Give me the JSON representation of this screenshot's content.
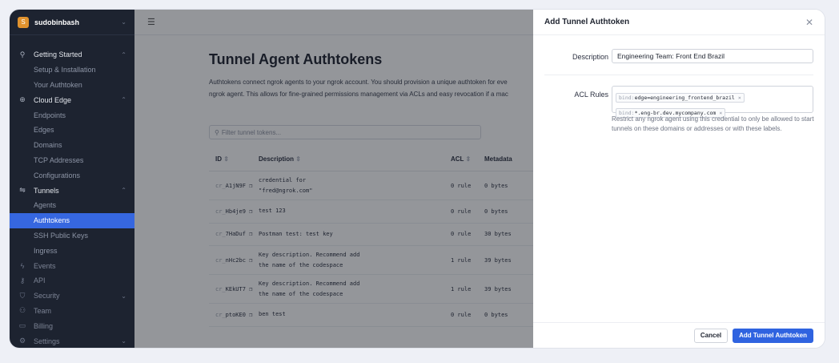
{
  "sidebar": {
    "account": {
      "initial": "S",
      "name": "sudobinbash"
    },
    "items": [
      {
        "label": "Getting Started",
        "type": "section",
        "icon": "rocket-icon",
        "glyph": "⚲",
        "caret": "^"
      },
      {
        "label": "Setup & Installation",
        "type": "sub"
      },
      {
        "label": "Your Authtoken",
        "type": "sub"
      },
      {
        "label": "Cloud Edge",
        "type": "section",
        "icon": "globe-icon",
        "glyph": "⊕",
        "caret": "^"
      },
      {
        "label": "Endpoints",
        "type": "sub"
      },
      {
        "label": "Edges",
        "type": "sub"
      },
      {
        "label": "Domains",
        "type": "sub"
      },
      {
        "label": "TCP Addresses",
        "type": "sub"
      },
      {
        "label": "Configurations",
        "type": "sub"
      },
      {
        "label": "Tunnels",
        "type": "section",
        "icon": "tunnel-icon",
        "glyph": "⇋",
        "caret": "^"
      },
      {
        "label": "Agents",
        "type": "sub"
      },
      {
        "label": "Authtokens",
        "type": "sub",
        "active": true
      },
      {
        "label": "SSH Public Keys",
        "type": "sub"
      },
      {
        "label": "Ingress",
        "type": "sub"
      },
      {
        "label": "Events",
        "type": "dim",
        "icon": "lightning-icon",
        "glyph": "ϟ"
      },
      {
        "label": "API",
        "type": "dim",
        "icon": "key-icon",
        "glyph": "⚷"
      },
      {
        "label": "Security",
        "type": "dim",
        "icon": "shield-icon",
        "glyph": "⛉",
        "caret": "v"
      },
      {
        "label": "Team",
        "type": "dim",
        "icon": "team-icon",
        "glyph": "⚇"
      },
      {
        "label": "Billing",
        "type": "dim",
        "icon": "billing-icon",
        "glyph": "▭"
      },
      {
        "label": "Settings",
        "type": "dim",
        "icon": "gear-icon",
        "glyph": "⚙",
        "caret": "v"
      }
    ]
  },
  "main": {
    "title": "Tunnel Agent Authtokens",
    "intro_line1": "Authtokens connect ngrok agents to your ngrok account. You should provision a unique authtoken for eve",
    "intro_line2": "ngrok agent. This allows for fine-grained permissions management via ACLs and easy revocation if a mac",
    "filter_placeholder": "Filter tunnel tokens...",
    "columns": {
      "id": "ID",
      "description": "Description",
      "acl": "ACL",
      "metadata": "Metadata"
    },
    "rows": [
      {
        "prefix": "cr_",
        "id": "A1jN9F",
        "desc1": "credential for",
        "desc2": "\"fred@ngrok.com\"",
        "acl": "0 rule",
        "meta": "0 bytes"
      },
      {
        "prefix": "cr_",
        "id": "Hb4je9",
        "desc1": "test 123",
        "desc2": "",
        "acl": "0 rule",
        "meta": "0 bytes"
      },
      {
        "prefix": "cr_",
        "id": "7HaDuf",
        "desc1": "Postman test: test key",
        "desc2": "",
        "acl": "0 rule",
        "meta": "30 bytes"
      },
      {
        "prefix": "cr_",
        "id": "nHc2bc",
        "desc1": "Key description. Recommend add",
        "desc2": "the name of the codespace",
        "acl": "1 rule",
        "meta": "39 bytes"
      },
      {
        "prefix": "cr_",
        "id": "KEkUT7",
        "desc1": "Key description. Recommend add",
        "desc2": "the name of the codespace",
        "acl": "1 rule",
        "meta": "39 bytes"
      },
      {
        "prefix": "cr_",
        "id": "ptoKE0",
        "desc1": "ben test",
        "desc2": "",
        "acl": "0 rule",
        "meta": "0 bytes"
      }
    ]
  },
  "drawer": {
    "title": "Add Tunnel Authtoken",
    "description_label": "Description",
    "description_value": "Engineering Team: Front End Brazil",
    "acl_label": "ACL Rules",
    "acl_chips": [
      {
        "prefix": "bind:",
        "value": "edge=engineering_frontend_brazil"
      },
      {
        "prefix": "bind:",
        "value": "*.eng-br.dev.mycompany.com"
      }
    ],
    "helper": "Restrict any ngrok agent using this credential to only be allowed to start tunnels on these domains or addresses or with these labels.",
    "cancel_label": "Cancel",
    "submit_label": "Add Tunnel Authtoken"
  },
  "colors": {
    "accent": "#2f63e0",
    "sidebar_bg": "#1d2330",
    "account_badge": "#e0922e"
  }
}
